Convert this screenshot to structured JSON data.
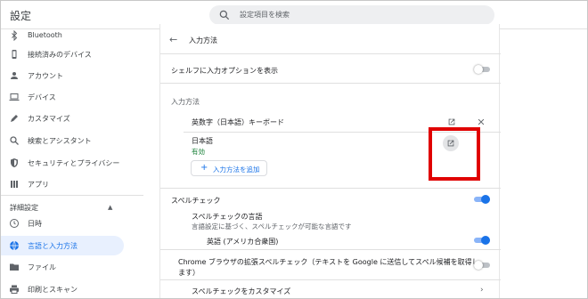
{
  "app": {
    "title": "設定"
  },
  "search": {
    "placeholder": "設定項目を検索",
    "icon": "search-icon"
  },
  "sidebar": {
    "items": [
      {
        "label": "Bluetooth",
        "icon": "bluetooth-icon"
      },
      {
        "label": "接続済みのデバイス",
        "icon": "phone-icon"
      },
      {
        "label": "アカウント",
        "icon": "person-icon"
      },
      {
        "label": "デバイス",
        "icon": "laptop-icon"
      },
      {
        "label": "カスタマイズ",
        "icon": "pen-icon"
      },
      {
        "label": "検索とアシスタント",
        "icon": "search-icon"
      },
      {
        "label": "セキュリティとプライバシー",
        "icon": "shield-icon"
      },
      {
        "label": "アプリ",
        "icon": "apps-grid-icon"
      }
    ],
    "advanced": {
      "label": "詳細設定",
      "items": [
        {
          "label": "日時",
          "icon": "clock-icon"
        },
        {
          "label": "言語と入力方法",
          "icon": "globe-icon",
          "active": true
        },
        {
          "label": "ファイル",
          "icon": "folder-icon"
        },
        {
          "label": "印刷とスキャン",
          "icon": "printer-icon"
        }
      ]
    }
  },
  "main": {
    "page_title": "入力方法",
    "shelf_option": {
      "label": "シェルフに入力オプションを表示",
      "enabled": false
    },
    "input_methods_heading": "入力方法",
    "input_methods": [
      {
        "name": "英数字（日本語）キーボード",
        "status": ""
      },
      {
        "name": "日本語",
        "status": "有効"
      }
    ],
    "add_button": "入力方法を追加",
    "spellcheck": {
      "label": "スペルチェック",
      "enabled": true,
      "languages_title": "スペルチェックの言語",
      "languages_desc": "言語設定に基づく、スペルチェックが可能な言語です",
      "language": {
        "label": "英語 (アメリカ合衆国)",
        "enabled": true
      },
      "enhanced": {
        "label_line1": "Chrome ブラウザの拡張スペルチェック（テキストを Google に送信してスペル候補を取得し",
        "label_line2": "ます）",
        "enabled": false
      },
      "customize": "スペルチェックをカスタマイズ"
    }
  },
  "colors": {
    "accent": "#1a73e8",
    "active_bg": "#e8f0fe",
    "status_green": "#188038",
    "highlight_red": "#e00000"
  }
}
